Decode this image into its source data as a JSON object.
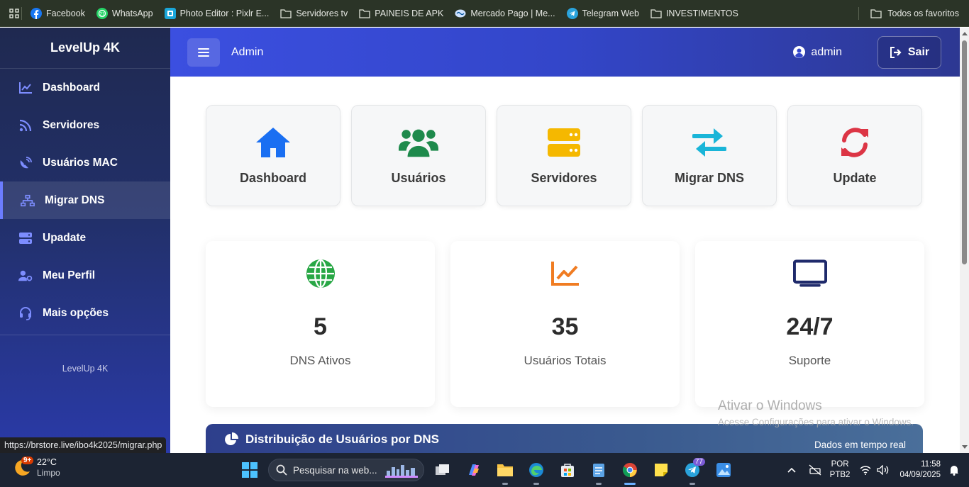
{
  "bookmarks": {
    "items": [
      {
        "label": "Facebook",
        "icon": "facebook-icon"
      },
      {
        "label": "WhatsApp",
        "icon": "whatsapp-icon"
      },
      {
        "label": "Photo Editor : Pixlr E...",
        "icon": "pixlr-icon"
      },
      {
        "label": "Servidores tv",
        "icon": "folder-icon"
      },
      {
        "label": "PAINEIS DE APK",
        "icon": "folder-icon"
      },
      {
        "label": "Mercado Pago | Me...",
        "icon": "mercadopago-icon"
      },
      {
        "label": "Telegram Web",
        "icon": "telegram-icon"
      },
      {
        "label": "INVESTIMENTOS",
        "icon": "folder-icon"
      }
    ],
    "all_favorites": "Todos os favoritos"
  },
  "sidebar": {
    "brand": "LevelUp 4K",
    "items": [
      {
        "label": "Dashboard",
        "icon": "chart-line-icon"
      },
      {
        "label": "Servidores",
        "icon": "rss-icon"
      },
      {
        "label": "Usuários MAC",
        "icon": "satellite-dish-icon"
      },
      {
        "label": "Migrar DNS",
        "icon": "sitemap-icon",
        "active": true
      },
      {
        "label": "Upadate",
        "icon": "server-icon"
      },
      {
        "label": "Meu Perfil",
        "icon": "user-cog-icon"
      },
      {
        "label": "Mais opções",
        "icon": "headset-icon"
      }
    ],
    "footer": "LevelUp 4K"
  },
  "header": {
    "title": "Admin",
    "user": "admin",
    "logout": "Sair"
  },
  "quick_cards": [
    {
      "label": "Dashboard",
      "icon": "home-icon",
      "color": "#1a6ff2"
    },
    {
      "label": "Usuários",
      "icon": "users-icon",
      "color": "#1e8a4c"
    },
    {
      "label": "Servidores",
      "icon": "server-icon",
      "color": "#f5b800"
    },
    {
      "label": "Migrar DNS",
      "icon": "exchange-icon",
      "color": "#19b5d8"
    },
    {
      "label": "Update",
      "icon": "sync-icon",
      "color": "#dc3545"
    }
  ],
  "stats": [
    {
      "value": "5",
      "label": "DNS Ativos",
      "icon": "globe-icon",
      "color": "#28a745"
    },
    {
      "value": "35",
      "label": "Usuários Totais",
      "icon": "chart-line-icon",
      "color": "#f07c22"
    },
    {
      "value": "24/7",
      "label": "Suporte",
      "icon": "tv-icon",
      "color": "#1f2a6b"
    }
  ],
  "chart_panel": {
    "title": "Distribuição de Usuários por DNS",
    "note": "Dados em tempo real"
  },
  "watermark": {
    "line1": "Ativar o Windows",
    "line2": "Acesse Configurações para ativar o Windows."
  },
  "status_url": "https://brstore.live/ibo4k2025/migrar.php",
  "taskbar": {
    "weather_temp": "22°C",
    "weather_cond": "Limpo",
    "weather_badge": "9+",
    "search_placeholder": "Pesquisar na web...",
    "telegram_badge": "77",
    "lang": "POR",
    "layout": "PTB2",
    "time": "11:58",
    "date": "04/09/2025"
  }
}
